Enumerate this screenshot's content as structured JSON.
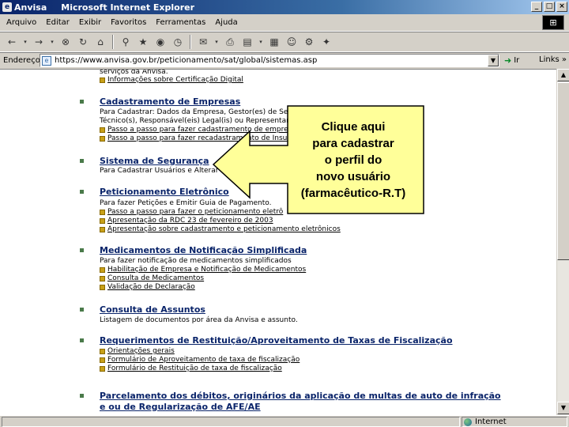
{
  "window": {
    "app_label": "Anvisa",
    "browser_title": "Microsoft Internet Explorer",
    "minimize": "_",
    "restore": "□",
    "close": "×"
  },
  "menu": [
    "Arquivo",
    "Editar",
    "Exibir",
    "Favoritos",
    "Ferramentas",
    "Ajuda"
  ],
  "address": {
    "label": "Endereço",
    "url": "https://www.anvisa.gov.br/peticionamento/sat/global/sistemas.asp",
    "go_label": "Ir",
    "links_label": "Links »"
  },
  "page": {
    "prev_text": "serviços da Anvisa.",
    "prev_link": "Informações sobre Certificação Digital",
    "sections": [
      {
        "title": "Cadastramento de Empresas",
        "desc": [
          "Para Cadastrar: Dados da Empresa, Gestor(es) de Se",
          "Técnico(s), Responsável(eis) Legal(is) ou Representan"
        ],
        "links": [
          "Passo a passo para fazer cadastramento de empre",
          "Passo a passo para fazer recadastramento de Insu"
        ]
      },
      {
        "title": "Sistema de Segurança",
        "desc": [
          "Para Cadastrar Usuários e Alterar se"
        ],
        "links": []
      },
      {
        "title": "Peticionamento Eletrônico",
        "desc": [
          "Para fazer Petições e Emitir Guia de Pagamento."
        ],
        "links": [
          "Passo a passo para fazer o peticionamento eletrô",
          "Apresentação da RDC 23 de fevereiro de 2003",
          "Apresentação sobre cadastramento e peticionamento eletrônicos"
        ]
      },
      {
        "title": "Medicamentos de Notificação Simplificada",
        "desc": [
          "Para fazer notificação de medicamentos simplificados"
        ],
        "links": [
          "Habilitação de Empresa e Notificação de Medicamentos",
          "Consulta de Medicamentos",
          "Validação de Declaração"
        ]
      },
      {
        "title": "Consulta de Assuntos",
        "desc": [
          "Listagem de documentos por área da Anvisa e assunto."
        ],
        "links": []
      },
      {
        "title": "Requerimentos de Restituição/Aproveitamento de Taxas de Fiscalização",
        "desc": [],
        "links": [
          "Orientações gerais",
          "Formulário de Aproveitamento de taxa de fiscalização",
          "Formulário de Restituição de taxa de fiscalização"
        ]
      },
      {
        "title": "Parcelamento dos débitos, originários da aplicação de multas de auto de infração",
        "title2": "e ou de Regularização de AFE/AE",
        "desc": [],
        "links": []
      }
    ]
  },
  "callout": {
    "lines": [
      "Clique aqui",
      "para cadastrar",
      "o perfil do",
      "novo usuário",
      "(farmacêutico-R.T)"
    ]
  },
  "status": {
    "zone": "Internet"
  }
}
